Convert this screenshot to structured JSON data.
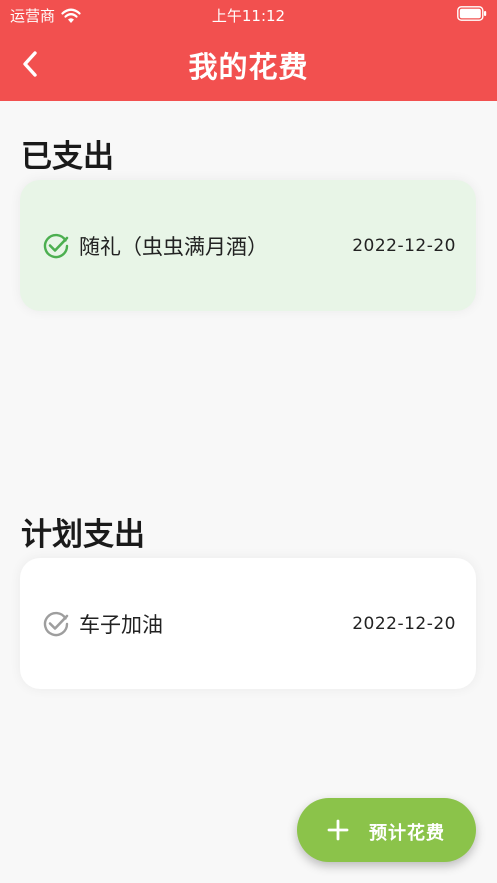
{
  "status_bar": {
    "carrier": "运营商",
    "time": "上午11:12"
  },
  "nav": {
    "title": "我的花费"
  },
  "spent_section": {
    "title": "已支出",
    "items": [
      {
        "name": "随礼（虫虫满月酒）",
        "date": "2022-12-20"
      }
    ]
  },
  "planned_section": {
    "title": "计划支出",
    "items": [
      {
        "name": "车子加油",
        "date": "2022-12-20"
      }
    ]
  },
  "fab": {
    "label": "预计花费"
  },
  "colors": {
    "header": "#f2504f",
    "spent_card": "#e8f5e7",
    "spent_check": "#4caf50",
    "planned_check": "#9e9e9e",
    "fab": "#8bc34a"
  }
}
